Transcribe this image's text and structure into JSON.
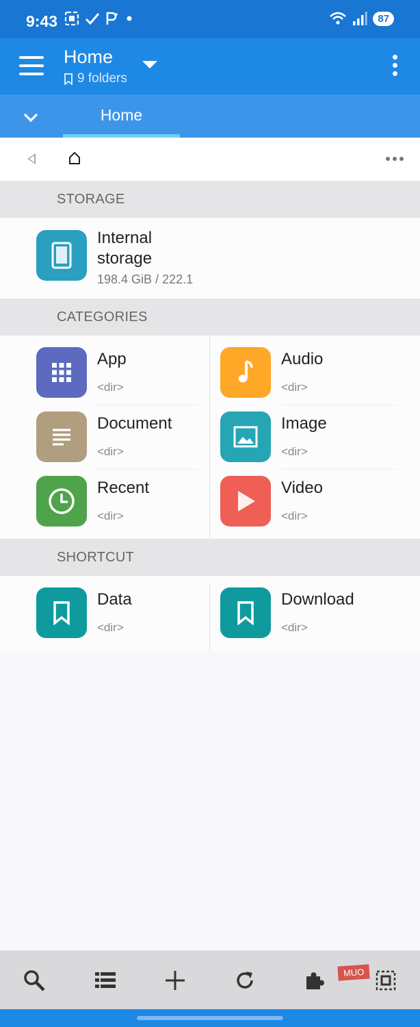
{
  "status": {
    "time": "9:43",
    "left_icons": [
      "screenshot-icon",
      "check-icon",
      "p-icon",
      "dot-icon"
    ],
    "battery": "87"
  },
  "appbar": {
    "title": "Home",
    "subtitle": "9 folders"
  },
  "tabs": [
    {
      "label": "Home",
      "active": true
    }
  ],
  "sections": {
    "storage": "STORAGE",
    "categories": "CATEGORIES",
    "shortcut": "SHORTCUT"
  },
  "storage": {
    "name": "Internal storage",
    "size": "198.4 GiB / 222.1"
  },
  "categories": [
    {
      "label": "App",
      "sub": "<dir>",
      "icon": "apps-grid-icon",
      "color": "#5c6bc0"
    },
    {
      "label": "Audio",
      "sub": "<dir>",
      "icon": "music-note-icon",
      "color": "#ffa726"
    },
    {
      "label": "Document",
      "sub": "<dir>",
      "icon": "document-icon",
      "color": "#b09e7f"
    },
    {
      "label": "Image",
      "sub": "<dir>",
      "icon": "image-icon",
      "color": "#26a6b4"
    },
    {
      "label": "Recent",
      "sub": "<dir>",
      "icon": "clock-icon",
      "color": "#4fa34a"
    },
    {
      "label": "Video",
      "sub": "<dir>",
      "icon": "play-icon",
      "color": "#ef5f56"
    }
  ],
  "shortcuts": [
    {
      "label": "Data",
      "sub": "<dir>",
      "icon": "bookmark-icon",
      "color": "#0f9b9e"
    },
    {
      "label": "Download",
      "sub": "<dir>",
      "icon": "bookmark-icon",
      "color": "#0f9b9e"
    }
  ],
  "storage_tile_color": "#2a9fbf",
  "bottombar": [
    "search-icon",
    "list-view-icon",
    "add-icon",
    "refresh-icon",
    "plugin-icon",
    "select-icon"
  ],
  "watermark": "MUO"
}
